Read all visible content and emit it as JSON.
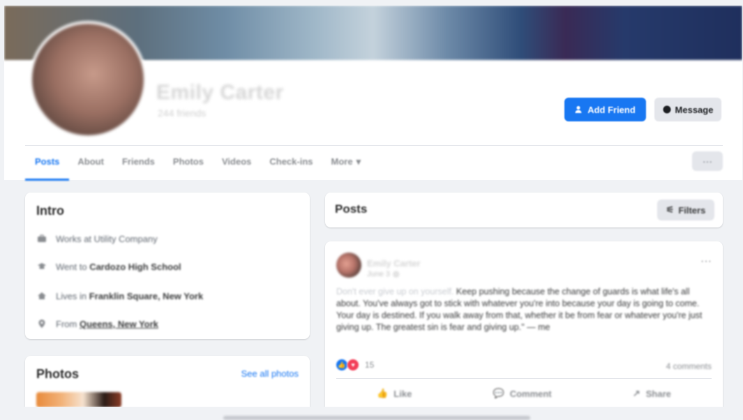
{
  "header": {
    "name": "Emily Carter",
    "subtitle": "244 friends",
    "add_friend_label": "Add Friend",
    "message_label": "Message",
    "dots_label": "···"
  },
  "tabs": [
    {
      "label": "Posts",
      "active": true
    },
    {
      "label": "About"
    },
    {
      "label": "Friends"
    },
    {
      "label": "Photos"
    },
    {
      "label": "Videos"
    },
    {
      "label": "Check-ins"
    },
    {
      "label": "More"
    }
  ],
  "intro": {
    "title": "Intro",
    "items": [
      {
        "icon": "briefcase-icon",
        "prefix": "Works at ",
        "bold": "Utility Company"
      },
      {
        "icon": "graduation-cap-icon",
        "prefix": "Went to ",
        "bold": "Cardozo High School"
      },
      {
        "icon": "home-icon",
        "prefix": "Lives in ",
        "bold": "Franklin Square, New York"
      },
      {
        "icon": "location-pin-icon",
        "prefix": "From ",
        "bold": "Queens, New York"
      }
    ]
  },
  "photos": {
    "title": "Photos",
    "see_all": "See all photos"
  },
  "posts": {
    "title": "Posts",
    "filters_label": "Filters"
  },
  "post": {
    "author": "Emily Carter",
    "date": "June 3",
    "more": "···",
    "text_faded": "Don't ever give up on yourself.",
    "text": " Keep pushing because the change of guards is what life's all about. You've always got to stick with whatever you're into because your day is going to come. Your day is destined. If you walk away from that, whether it be from fear or whatever you're just giving up. The greatest sin is fear and giving up.\" — me",
    "reaction_count": "15",
    "comments": "4 comments",
    "actions": [
      "Like",
      "Comment",
      "Share"
    ]
  },
  "colors": {
    "brand": "#1877f2",
    "background": "#f0f2f5"
  }
}
